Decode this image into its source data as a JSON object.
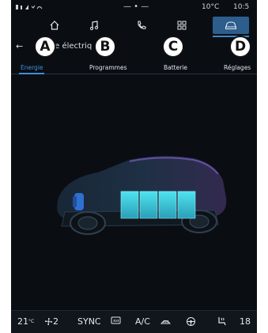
{
  "status": {
    "temp": "10°C",
    "clock": "10:5"
  },
  "header": {
    "back_label": "←",
    "title_partial": "ule électriq"
  },
  "tabs": [
    {
      "label": "Energie"
    },
    {
      "label": "Programmes"
    },
    {
      "label": "Batterie"
    },
    {
      "label": "Réglages"
    }
  ],
  "callouts": [
    "A",
    "B",
    "C",
    "D"
  ],
  "nav_icons": [
    "home-icon",
    "music-icon",
    "phone-icon",
    "apps-icon",
    "car-icon"
  ],
  "climate": {
    "left_temp": "21",
    "left_unit": "°C",
    "fan_speed": "2",
    "sync_label": "SYNC",
    "ac_label": "A/C",
    "right_temp": "18"
  },
  "colors": {
    "accent": "#3f90d8",
    "battery": "#3fd0d8",
    "background": "#0a0e13"
  }
}
